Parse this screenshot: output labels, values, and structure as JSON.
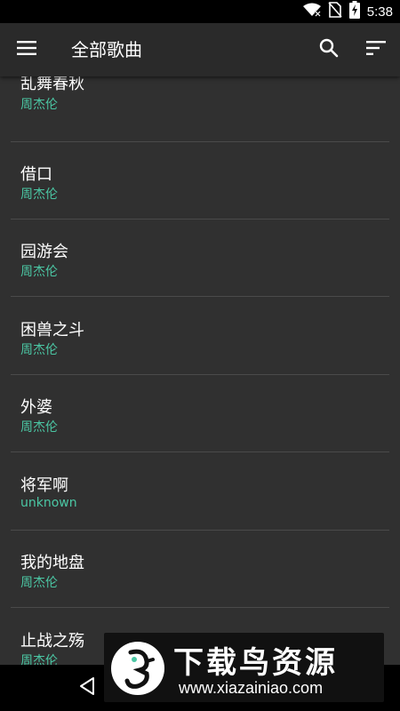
{
  "status_bar": {
    "time": "5:38",
    "icons": [
      "wifi-icon",
      "no-sim-icon",
      "battery-charging-icon"
    ]
  },
  "app_bar": {
    "title": "全部歌曲",
    "menu_icon": "hamburger-menu-icon",
    "search_icon": "search-icon",
    "sort_icon": "sort-icon"
  },
  "songs": [
    {
      "title": "乱舞春秋",
      "artist": "周杰伦"
    },
    {
      "title": "借口",
      "artist": "周杰伦"
    },
    {
      "title": "园游会",
      "artist": "周杰伦"
    },
    {
      "title": "困兽之斗",
      "artist": "周杰伦"
    },
    {
      "title": "外婆",
      "artist": "周杰伦"
    },
    {
      "title": "将军啊",
      "artist": "unknown"
    },
    {
      "title": "我的地盘",
      "artist": "周杰伦"
    },
    {
      "title": "止战之殇",
      "artist": "周杰伦"
    }
  ],
  "nav_bar": {
    "back_icon": "back-triangle-icon"
  },
  "watermark": {
    "name": "下载鸟资源",
    "url": "www.xiazainiao.com"
  },
  "colors": {
    "accent": "#4bc7a4",
    "background": "#303030",
    "app_bar": "#2a2a2a",
    "divider": "#4a4a4a"
  }
}
